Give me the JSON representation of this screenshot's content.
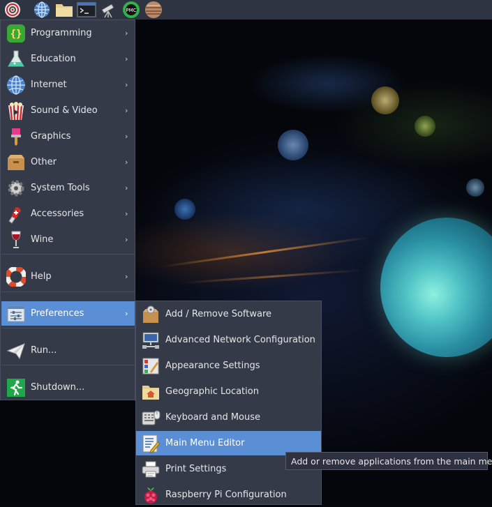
{
  "panel": {
    "buttons": [
      {
        "name": "raspberry-menu-icon"
      },
      {
        "name": "web-browser-icon"
      },
      {
        "name": "file-manager-icon"
      },
      {
        "name": "terminal-icon"
      },
      {
        "name": "telescope-icon"
      },
      {
        "name": "pmc-app-icon"
      },
      {
        "name": "planet-app-icon"
      }
    ]
  },
  "menu": {
    "items": [
      {
        "label": "Programming",
        "icon": "braces-icon",
        "has_submenu": true
      },
      {
        "label": "Education",
        "icon": "flask-icon",
        "has_submenu": true
      },
      {
        "label": "Internet",
        "icon": "globe-icon",
        "has_submenu": true
      },
      {
        "label": "Sound & Video",
        "icon": "film-popcorn-icon",
        "has_submenu": true
      },
      {
        "label": "Graphics",
        "icon": "paintbrush-icon",
        "has_submenu": true
      },
      {
        "label": "Other",
        "icon": "box-icon",
        "has_submenu": true
      },
      {
        "label": "System Tools",
        "icon": "gear-icon",
        "has_submenu": true
      },
      {
        "label": "Accessories",
        "icon": "swiss-knife-icon",
        "has_submenu": true
      },
      {
        "label": "Wine",
        "icon": "wine-glass-icon",
        "has_submenu": true
      },
      {
        "label": "Help",
        "icon": "lifebuoy-icon",
        "has_submenu": true
      },
      {
        "label": "Preferences",
        "icon": "preferences-sliders-icon",
        "has_submenu": true,
        "active": true
      },
      {
        "label": "Run...",
        "icon": "paper-plane-icon",
        "has_submenu": false
      },
      {
        "label": "Shutdown...",
        "icon": "exit-runner-icon",
        "has_submenu": false
      }
    ],
    "arrow": "›"
  },
  "submenu": {
    "items": [
      {
        "label": "Add / Remove Software",
        "icon": "package-icon"
      },
      {
        "label": "Advanced Network Configuration",
        "icon": "network-icon"
      },
      {
        "label": "Appearance Settings",
        "icon": "palette-icon"
      },
      {
        "label": "Geographic Location",
        "icon": "home-folder-icon"
      },
      {
        "label": "Keyboard and Mouse",
        "icon": "keyboard-mouse-icon"
      },
      {
        "label": "Main Menu Editor",
        "icon": "menu-editor-icon",
        "active": true
      },
      {
        "label": "Print Settings",
        "icon": "printer-icon"
      },
      {
        "label": "Raspberry Pi Configuration",
        "icon": "raspberry-icon"
      }
    ]
  },
  "tooltip": {
    "text": "Add or remove applications from the main menu"
  },
  "colors": {
    "menu_bg": "#353a49",
    "highlight": "#5a8fd6",
    "panel_bg": "#2f3443"
  }
}
